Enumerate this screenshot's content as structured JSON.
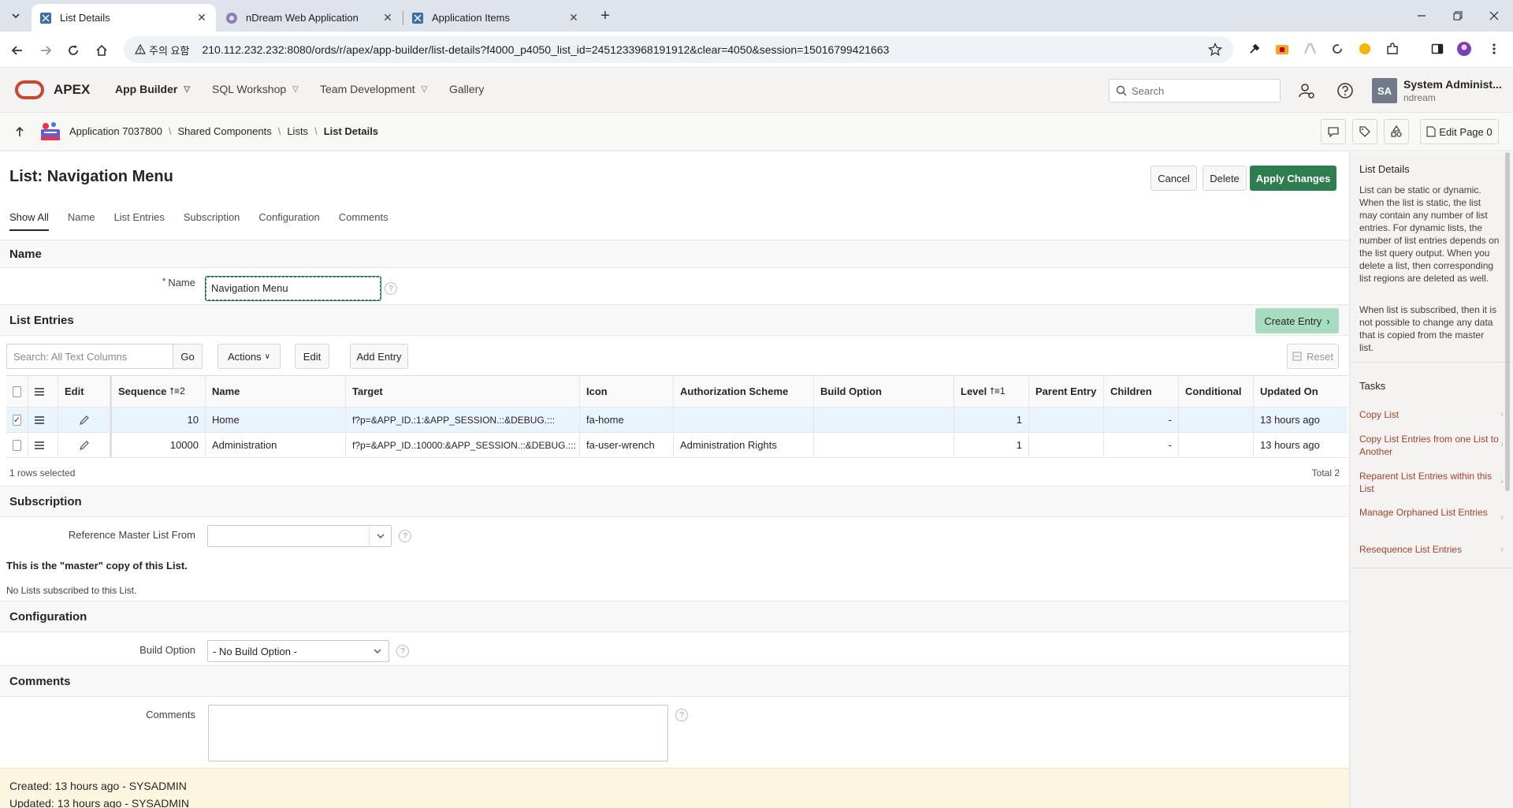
{
  "browser": {
    "tabs": [
      {
        "title": "List Details",
        "active": true
      },
      {
        "title": "nDream Web Application",
        "active": false
      },
      {
        "title": "Application Items",
        "active": false
      }
    ],
    "security_chip": "주의 요함",
    "url": "210.112.232.232:8080/ords/r/apex/app-builder/list-details?f4000_p4050_list_id=2451233968191912&clear=4050&session=15016799421663"
  },
  "apex": {
    "brand": "APEX",
    "menus": [
      "App Builder",
      "SQL Workshop",
      "Team Development",
      "Gallery"
    ],
    "search_placeholder": "Search",
    "user": {
      "initials": "SA",
      "name": "System Administ...",
      "workspace": "ndream"
    }
  },
  "breadcrumb": {
    "items": [
      "Application 7037800",
      "Shared Components",
      "Lists"
    ],
    "current": "List Details",
    "edit_page": "Edit Page 0"
  },
  "page": {
    "title": "List: Navigation Menu",
    "buttons": {
      "cancel": "Cancel",
      "delete": "Delete",
      "apply": "Apply Changes"
    },
    "tabs": [
      "Show All",
      "Name",
      "List Entries",
      "Subscription",
      "Configuration",
      "Comments"
    ]
  },
  "name_section": {
    "heading": "Name",
    "label": "Name",
    "value": "Navigation Menu"
  },
  "list_entries": {
    "heading": "List Entries",
    "create_button": "Create Entry",
    "search_placeholder": "Search: All Text Columns",
    "go": "Go",
    "actions": "Actions",
    "edit": "Edit",
    "add_entry": "Add Entry",
    "reset": "Reset",
    "columns": {
      "edit": "Edit",
      "sequence": "Sequence",
      "sequence_sort": "⭡≡2",
      "name": "Name",
      "target": "Target",
      "icon": "Icon",
      "auth": "Authorization Scheme",
      "build": "Build Option",
      "level": "Level",
      "level_sort": "⭡≡1",
      "parent": "Parent Entry",
      "children": "Children",
      "conditional": "Conditional",
      "updated": "Updated On"
    },
    "rows": [
      {
        "selected": true,
        "sequence": "10",
        "name": "Home",
        "target": "f?p=&APP_ID.:1:&APP_SESSION.::&DEBUG.:::",
        "icon": "fa-home",
        "auth": "",
        "build": "",
        "level": "1",
        "parent": "",
        "children": "-",
        "conditional": "",
        "updated": "13 hours ago"
      },
      {
        "selected": false,
        "sequence": "10000",
        "name": "Administration",
        "target": "f?p=&APP_ID.:10000:&APP_SESSION.::&DEBUG.:::",
        "icon": "fa-user-wrench",
        "auth": "Administration Rights",
        "build": "",
        "level": "1",
        "parent": "",
        "children": "-",
        "conditional": "",
        "updated": "13 hours ago"
      }
    ],
    "selected_text": "1 rows selected",
    "total_text": "Total 2"
  },
  "subscription": {
    "heading": "Subscription",
    "label": "Reference Master List From",
    "value": "",
    "master_note": "This is the \"master\" copy of this List.",
    "no_subs": "No Lists subscribed to this List."
  },
  "configuration": {
    "heading": "Configuration",
    "label": "Build Option",
    "value": "- No Build Option -"
  },
  "comments": {
    "heading": "Comments",
    "label": "Comments",
    "value": ""
  },
  "audit": {
    "created": "Created: 13 hours ago - SYSADMIN",
    "updated": "Updated: 13 hours ago - SYSADMIN"
  },
  "sidebar": {
    "title": "List Details",
    "para1": "List can be static or dynamic. When the list is static, the list may contain any number of list entries. For dynamic lists, the number of list entries depends on the list query output. When you delete a list, then corresponding list regions are deleted as well.",
    "para2": "When list is subscribed, then it is not possible to change any data that is copied from the master list.",
    "tasks_title": "Tasks",
    "tasks": [
      "Copy List",
      "Copy List Entries from one List to Another",
      "Reparent List Entries within this List",
      "Manage Orphaned List Entries",
      "Resequence List Entries"
    ]
  },
  "colors": {
    "accent": "#2e7d4f",
    "brand": "#c74634",
    "task_link": "#a5402a",
    "audit_bg": "#fcf6e1"
  }
}
